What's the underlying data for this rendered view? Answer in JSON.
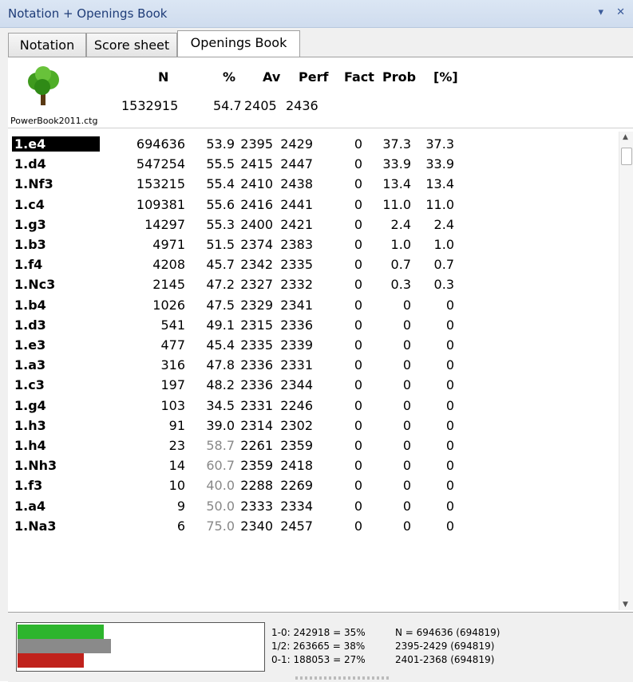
{
  "window": {
    "title": "Notation + Openings Book",
    "controls": "▾ ✕"
  },
  "tabs": [
    {
      "label": "Notation"
    },
    {
      "label": "Score sheet"
    },
    {
      "label": "Openings Book",
      "active": true
    }
  ],
  "header": {
    "cols": [
      "N",
      "%",
      "Av",
      "Perf",
      "Fact",
      "Prob",
      "[%]"
    ],
    "book_name": "PowerBook2011.ctg",
    "totals": {
      "n": "1532915",
      "pct": "54.7",
      "av": "2405",
      "perf": "2436"
    }
  },
  "moves": [
    {
      "move": "1.e4",
      "n": "694636",
      "pct": "53.9",
      "av": "2395",
      "perf": "2429",
      "fact": "0",
      "prob": "37.3",
      "share": "37.3",
      "selected": true
    },
    {
      "move": "1.d4",
      "n": "547254",
      "pct": "55.5",
      "av": "2415",
      "perf": "2447",
      "fact": "0",
      "prob": "33.9",
      "share": "33.9"
    },
    {
      "move": "1.Nf3",
      "n": "153215",
      "pct": "55.4",
      "av": "2410",
      "perf": "2438",
      "fact": "0",
      "prob": "13.4",
      "share": "13.4"
    },
    {
      "move": "1.c4",
      "n": "109381",
      "pct": "55.6",
      "av": "2416",
      "perf": "2441",
      "fact": "0",
      "prob": "11.0",
      "share": "11.0"
    },
    {
      "move": "1.g3",
      "n": "14297",
      "pct": "55.3",
      "av": "2400",
      "perf": "2421",
      "fact": "0",
      "prob": "2.4",
      "share": "2.4"
    },
    {
      "move": "1.b3",
      "n": "4971",
      "pct": "51.5",
      "av": "2374",
      "perf": "2383",
      "fact": "0",
      "prob": "1.0",
      "share": "1.0"
    },
    {
      "move": "1.f4",
      "n": "4208",
      "pct": "45.7",
      "av": "2342",
      "perf": "2335",
      "fact": "0",
      "prob": "0.7",
      "share": "0.7"
    },
    {
      "move": "1.Nc3",
      "n": "2145",
      "pct": "47.2",
      "av": "2327",
      "perf": "2332",
      "fact": "0",
      "prob": "0.3",
      "share": "0.3"
    },
    {
      "move": "1.b4",
      "n": "1026",
      "pct": "47.5",
      "av": "2329",
      "perf": "2341",
      "fact": "0",
      "prob": "0",
      "share": "0"
    },
    {
      "move": "1.d3",
      "n": "541",
      "pct": "49.1",
      "av": "2315",
      "perf": "2336",
      "fact": "0",
      "prob": "0",
      "share": "0"
    },
    {
      "move": "1.e3",
      "n": "477",
      "pct": "45.4",
      "av": "2335",
      "perf": "2339",
      "fact": "0",
      "prob": "0",
      "share": "0"
    },
    {
      "move": "1.a3",
      "n": "316",
      "pct": "47.8",
      "av": "2336",
      "perf": "2331",
      "fact": "0",
      "prob": "0",
      "share": "0"
    },
    {
      "move": "1.c3",
      "n": "197",
      "pct": "48.2",
      "av": "2336",
      "perf": "2344",
      "fact": "0",
      "prob": "0",
      "share": "0"
    },
    {
      "move": "1.g4",
      "n": "103",
      "pct": "34.5",
      "av": "2331",
      "perf": "2246",
      "fact": "0",
      "prob": "0",
      "share": "0"
    },
    {
      "move": "1.h3",
      "n": "91",
      "pct": "39.0",
      "av": "2314",
      "perf": "2302",
      "fact": "0",
      "prob": "0",
      "share": "0"
    },
    {
      "move": "1.h4",
      "n": "23",
      "pct": "58.7",
      "av": "2261",
      "perf": "2359",
      "fact": "0",
      "prob": "0",
      "share": "0",
      "pct_gray": true
    },
    {
      "move": "1.Nh3",
      "n": "14",
      "pct": "60.7",
      "av": "2359",
      "perf": "2418",
      "fact": "0",
      "prob": "0",
      "share": "0",
      "pct_gray": true
    },
    {
      "move": "1.f3",
      "n": "10",
      "pct": "40.0",
      "av": "2288",
      "perf": "2269",
      "fact": "0",
      "prob": "0",
      "share": "0",
      "pct_gray": true
    },
    {
      "move": "1.a4",
      "n": "9",
      "pct": "50.0",
      "av": "2333",
      "perf": "2334",
      "fact": "0",
      "prob": "0",
      "share": "0",
      "pct_gray": true
    },
    {
      "move": "1.Na3",
      "n": "6",
      "pct": "75.0",
      "av": "2340",
      "perf": "2457",
      "fact": "0",
      "prob": "0",
      "share": "0",
      "pct_gray": true
    }
  ],
  "footer": {
    "bars": [
      {
        "name": "win",
        "fraction": 0.35,
        "color": "#2db52d"
      },
      {
        "name": "draw",
        "fraction": 0.38,
        "color": "#8a8a8a"
      },
      {
        "name": "loss",
        "fraction": 0.27,
        "color": "#c0221c"
      }
    ],
    "results": [
      "1-0: 242918 = 35%",
      "1/2: 263665 = 38%",
      "0-1: 188053 = 27%"
    ],
    "summary": [
      "N = 694636 (694819)",
      "2395-2429 (694819)",
      "2401-2368 (694819)"
    ]
  },
  "colors": {
    "selected_bg": "#000000",
    "title_text": "#1e3c78"
  }
}
